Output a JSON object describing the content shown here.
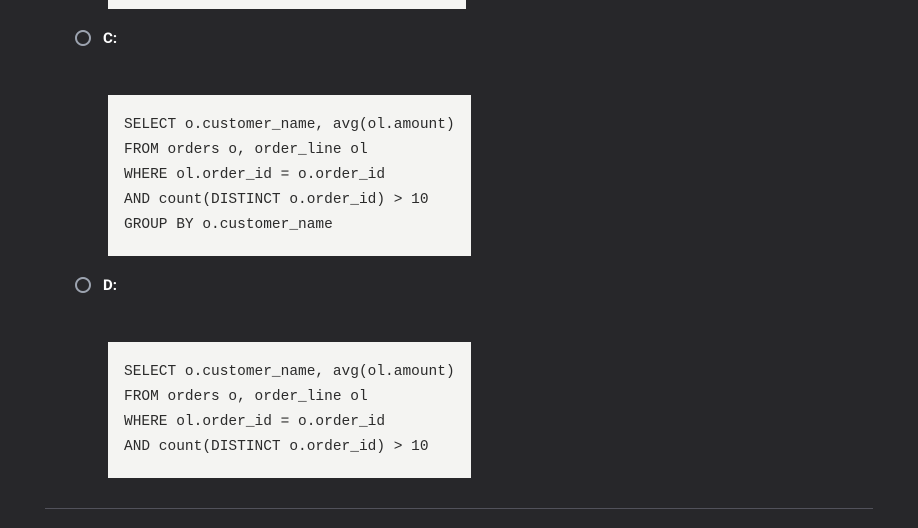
{
  "options": {
    "c": {
      "label": "C:",
      "code": "SELECT o.customer_name, avg(ol.amount)\nFROM orders o, order_line ol\nWHERE ol.order_id = o.order_id\nAND count(DISTINCT o.order_id) > 10\nGROUP BY o.customer_name"
    },
    "d": {
      "label": "D:",
      "code": "SELECT o.customer_name, avg(ol.amount)\nFROM orders o, order_line ol\nWHERE ol.order_id = o.order_id\nAND count(DISTINCT o.order_id) > 10"
    }
  }
}
